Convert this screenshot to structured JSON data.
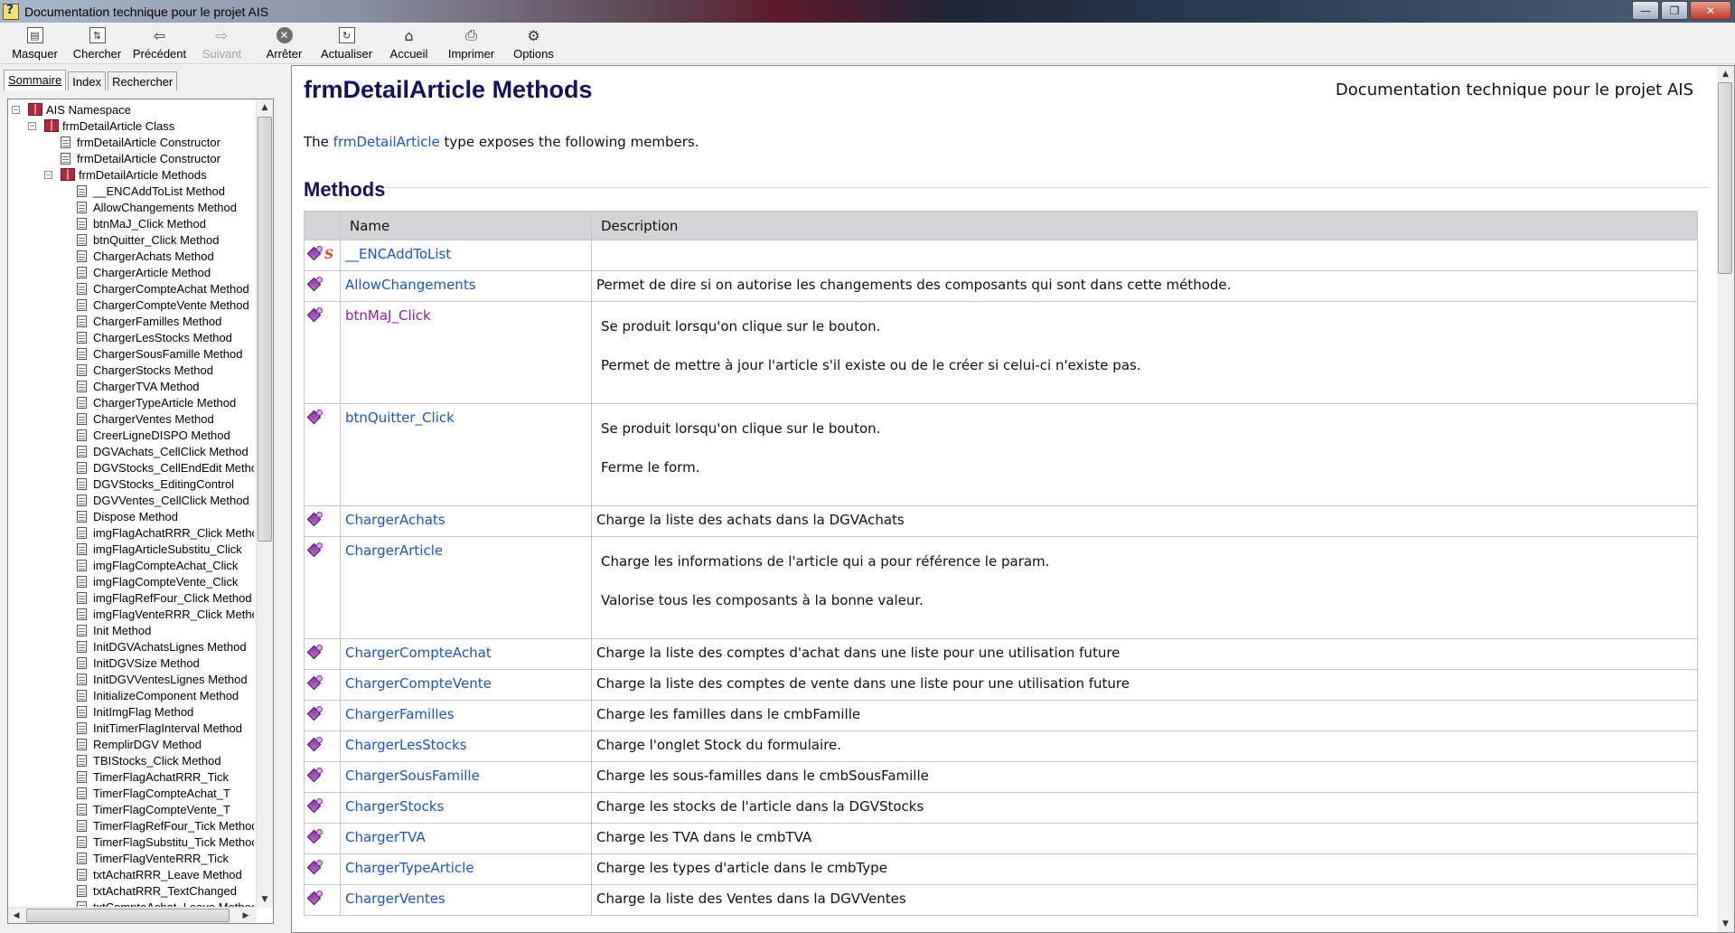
{
  "window": {
    "title": "Documentation technique pour le projet AIS"
  },
  "toolbar": {
    "buttons": [
      {
        "label": "Masquer",
        "icon": "hide-pane-icon"
      },
      {
        "label": "Chercher",
        "icon": "locate-icon"
      },
      {
        "label": "Précédent",
        "icon": "back-arrow-icon"
      },
      {
        "label": "Suivant",
        "icon": "forward-arrow-icon",
        "disabled": true
      },
      {
        "label": "Arrêter",
        "icon": "stop-icon"
      },
      {
        "label": "Actualiser",
        "icon": "refresh-icon"
      },
      {
        "label": "Accueil",
        "icon": "home-icon"
      },
      {
        "label": "Imprimer",
        "icon": "print-icon"
      },
      {
        "label": "Options",
        "icon": "options-icon"
      }
    ]
  },
  "nav": {
    "tabs": [
      "Sommaire",
      "Index",
      "Rechercher"
    ],
    "tree": [
      {
        "label": "AIS Namespace",
        "level": 0,
        "type": "book",
        "expanded": true
      },
      {
        "label": "frmDetailArticle Class",
        "level": 1,
        "type": "book",
        "expanded": true
      },
      {
        "label": "frmDetailArticle Constructor",
        "level": 2,
        "type": "page"
      },
      {
        "label": "frmDetailArticle Constructor",
        "level": 2,
        "type": "page"
      },
      {
        "label": "frmDetailArticle Methods",
        "level": 2,
        "type": "book",
        "expanded": true,
        "selected": true
      },
      {
        "label": "__ENCAddToList Method",
        "level": 3,
        "type": "page"
      },
      {
        "label": "AllowChangements Method",
        "level": 3,
        "type": "page"
      },
      {
        "label": "btnMaJ_Click Method",
        "level": 3,
        "type": "page"
      },
      {
        "label": "btnQuitter_Click Method",
        "level": 3,
        "type": "page"
      },
      {
        "label": "ChargerAchats Method",
        "level": 3,
        "type": "page"
      },
      {
        "label": "ChargerArticle Method",
        "level": 3,
        "type": "page"
      },
      {
        "label": "ChargerCompteAchat Method",
        "level": 3,
        "type": "page"
      },
      {
        "label": "ChargerCompteVente Method",
        "level": 3,
        "type": "page"
      },
      {
        "label": "ChargerFamilles Method",
        "level": 3,
        "type": "page"
      },
      {
        "label": "ChargerLesStocks Method",
        "level": 3,
        "type": "page"
      },
      {
        "label": "ChargerSousFamille Method",
        "level": 3,
        "type": "page"
      },
      {
        "label": "ChargerStocks Method",
        "level": 3,
        "type": "page"
      },
      {
        "label": "ChargerTVA Method",
        "level": 3,
        "type": "page"
      },
      {
        "label": "ChargerTypeArticle Method",
        "level": 3,
        "type": "page"
      },
      {
        "label": "ChargerVentes Method",
        "level": 3,
        "type": "page"
      },
      {
        "label": "CreerLigneDISPO Method",
        "level": 3,
        "type": "page"
      },
      {
        "label": "DGVAchats_CellClick Method",
        "level": 3,
        "type": "page"
      },
      {
        "label": "DGVStocks_CellEndEdit Method",
        "level": 3,
        "type": "page"
      },
      {
        "label": "DGVStocks_EditingControl",
        "level": 3,
        "type": "page"
      },
      {
        "label": "DGVVentes_CellClick Method",
        "level": 3,
        "type": "page"
      },
      {
        "label": "Dispose Method",
        "level": 3,
        "type": "page"
      },
      {
        "label": "imgFlagAchatRRR_Click Method",
        "level": 3,
        "type": "page"
      },
      {
        "label": "imgFlagArticleSubstitu_Click",
        "level": 3,
        "type": "page"
      },
      {
        "label": "imgFlagCompteAchat_Click",
        "level": 3,
        "type": "page"
      },
      {
        "label": "imgFlagCompteVente_Click",
        "level": 3,
        "type": "page"
      },
      {
        "label": "imgFlagRefFour_Click Method",
        "level": 3,
        "type": "page"
      },
      {
        "label": "imgFlagVenteRRR_Click Method",
        "level": 3,
        "type": "page"
      },
      {
        "label": "Init Method",
        "level": 3,
        "type": "page"
      },
      {
        "label": "InitDGVAchatsLignes Method",
        "level": 3,
        "type": "page"
      },
      {
        "label": "InitDGVSize Method",
        "level": 3,
        "type": "page"
      },
      {
        "label": "InitDGVVentesLignes Method",
        "level": 3,
        "type": "page"
      },
      {
        "label": "InitializeComponent Method",
        "level": 3,
        "type": "page"
      },
      {
        "label": "InitImgFlag Method",
        "level": 3,
        "type": "page"
      },
      {
        "label": "InitTimerFlagInterval Method",
        "level": 3,
        "type": "page"
      },
      {
        "label": "RemplirDGV Method",
        "level": 3,
        "type": "page"
      },
      {
        "label": "TBIStocks_Click Method",
        "level": 3,
        "type": "page"
      },
      {
        "label": "TimerFlagAchatRRR_Tick",
        "level": 3,
        "type": "page"
      },
      {
        "label": "TimerFlagCompteAchat_T",
        "level": 3,
        "type": "page"
      },
      {
        "label": "TimerFlagCompteVente_T",
        "level": 3,
        "type": "page"
      },
      {
        "label": "TimerFlagRefFour_Tick Method",
        "level": 3,
        "type": "page"
      },
      {
        "label": "TimerFlagSubstitu_Tick Method",
        "level": 3,
        "type": "page"
      },
      {
        "label": "TimerFlagVenteRRR_Tick",
        "level": 3,
        "type": "page"
      },
      {
        "label": "txtAchatRRR_Leave Method",
        "level": 3,
        "type": "page"
      },
      {
        "label": "txtAchatRRR_TextChanged",
        "level": 3,
        "type": "page"
      },
      {
        "label": "txtCompteAchat_Leave Method",
        "level": 3,
        "type": "page"
      }
    ]
  },
  "content": {
    "title": "frmDetailArticle Methods",
    "project": "Documentation technique pour le projet AIS",
    "intro_prefix": "The ",
    "intro_link": "frmDetailArticle",
    "intro_suffix": " type exposes the following members.",
    "section": "Methods",
    "columns": [
      "",
      "Name",
      "Description"
    ],
    "methods": [
      {
        "name": "__ENCAddToList",
        "static": true,
        "desc": []
      },
      {
        "name": "AllowChangements",
        "desc": [
          "Permet de dire si on autorise les changements des composants qui sont dans cette méthode."
        ]
      },
      {
        "name": "btnMaJ_Click",
        "visited": true,
        "desc": [
          "Se produit lorsqu'on clique sur le bouton.",
          "Permet de mettre à jour l'article s'il existe ou de le créer si celui-ci n'existe pas."
        ]
      },
      {
        "name": "btnQuitter_Click",
        "desc": [
          "Se produit lorsqu'on clique sur le bouton.",
          "Ferme le form."
        ]
      },
      {
        "name": "ChargerAchats",
        "desc": [
          "Charge la liste des achats dans la DGVAchats"
        ]
      },
      {
        "name": "ChargerArticle",
        "desc": [
          "Charge les informations de l'article qui a pour référence le param.",
          "Valorise tous les composants à la bonne valeur."
        ]
      },
      {
        "name": "ChargerCompteAchat",
        "desc": [
          "Charge la liste des comptes d'achat dans une liste pour une utilisation future"
        ]
      },
      {
        "name": "ChargerCompteVente",
        "desc": [
          "Charge la liste des comptes de vente dans une liste pour une utilisation future"
        ]
      },
      {
        "name": "ChargerFamilles",
        "desc": [
          "Charge les familles dans le cmbFamille"
        ]
      },
      {
        "name": "ChargerLesStocks",
        "desc": [
          "Charge l'onglet Stock du formulaire."
        ]
      },
      {
        "name": "ChargerSousFamille",
        "desc": [
          "Charge les sous-familles dans le cmbSousFamille"
        ]
      },
      {
        "name": "ChargerStocks",
        "desc": [
          "Charge les stocks de l'article dans la DGVStocks"
        ]
      },
      {
        "name": "ChargerTVA",
        "desc": [
          "Charge les TVA dans le cmbTVA"
        ]
      },
      {
        "name": "ChargerTypeArticle",
        "desc": [
          "Charge les types d'article dans le cmbType"
        ]
      },
      {
        "name": "ChargerVentes",
        "desc": [
          "Charge la liste des Ventes dans la DGVVentes"
        ]
      }
    ]
  },
  "colors": {
    "link": "#1b55c0",
    "visited": "#8b1fa3",
    "heading": "#14125e",
    "table_header": "#d4d3d5"
  }
}
